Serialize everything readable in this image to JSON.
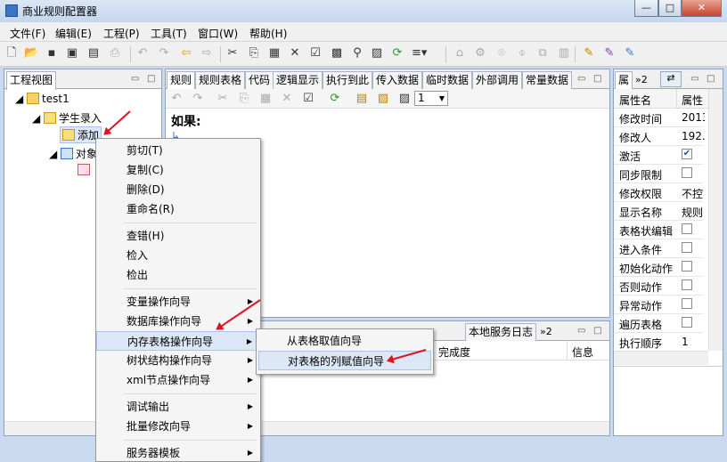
{
  "window": {
    "title": "商业规则配置器",
    "min_label": "—",
    "max_label": "□",
    "close_label": "✕"
  },
  "menubar": [
    "文件(F)",
    "编辑(E)",
    "工程(P)",
    "工具(T)",
    "窗口(W)",
    "帮助(H)"
  ],
  "project_view": {
    "tab": "工程视图",
    "root": "test1",
    "student": "学生录入",
    "add": "添加",
    "obj": "对象"
  },
  "editor": {
    "tabs": [
      "规则",
      "规则表格",
      "代码",
      "逻辑显示",
      "执行到此",
      "传入数据",
      "临时数据",
      "外部调用",
      "常量数据"
    ],
    "content": "如果:",
    "combo_value": "1"
  },
  "context_menu": {
    "items": [
      "剪切(T)",
      "复制(C)",
      "删除(D)",
      "重命名(R)",
      "查错(H)",
      "检入",
      "检出",
      "变量操作向导",
      "数据库操作向导",
      "内存表格操作向导",
      "树状结构操作向导",
      "xml节点操作向导",
      "调试输出",
      "批量修改向导",
      "服务器模板"
    ]
  },
  "submenu": {
    "items": [
      "从表格取值向导",
      "对表格的列赋值向导"
    ]
  },
  "bottom": {
    "tabs": [
      "本地服务日志"
    ],
    "overflow": "»2",
    "columns": [
      "完成度",
      "信息"
    ]
  },
  "properties": {
    "tab": "属",
    "overflow": "»2",
    "col_name": "属性名",
    "col_value": "属性",
    "rows": [
      {
        "k": "修改时间",
        "v": "2013"
      },
      {
        "k": "修改人",
        "v": "192."
      },
      {
        "k": "激活",
        "v": "✔"
      },
      {
        "k": "同步限制",
        "v": ""
      },
      {
        "k": "修改权限",
        "v": "不控"
      },
      {
        "k": "显示名称",
        "v": "规则"
      },
      {
        "k": "表格状编辑",
        "v": ""
      },
      {
        "k": "进入条件",
        "v": ""
      },
      {
        "k": "初始化动作",
        "v": ""
      },
      {
        "k": "否则动作",
        "v": ""
      },
      {
        "k": "异常动作",
        "v": ""
      },
      {
        "k": "遍历表格",
        "v": ""
      },
      {
        "k": "执行顺序",
        "v": "1"
      }
    ]
  },
  "colors": {
    "accent": "#3a73c8",
    "arrow": "#e0141e"
  }
}
